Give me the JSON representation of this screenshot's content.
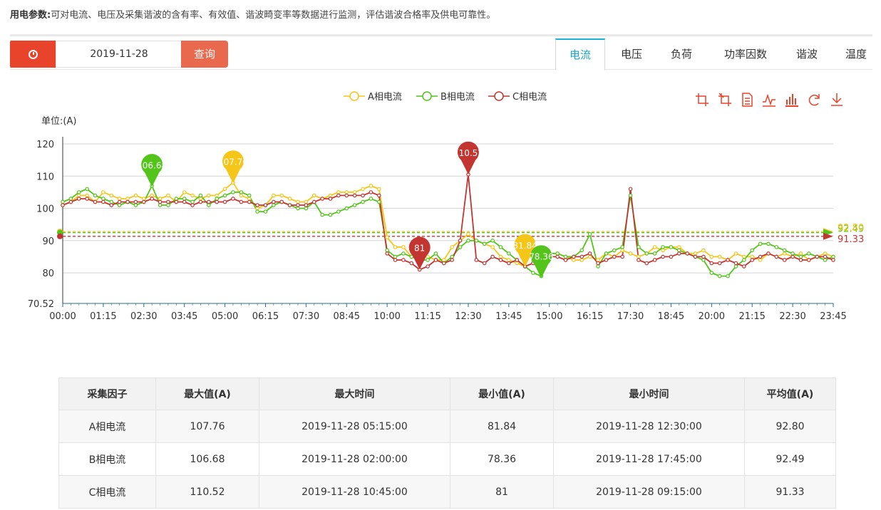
{
  "intro": {
    "label": "用电参数:",
    "text": "可对电流、电压及采集谐波的含有率、有效值、谐波畸变率等数据进行监测，评估谐波合格率及供电可靠性。"
  },
  "controls": {
    "clock_icon": "clock-icon",
    "date": "2019-11-28",
    "query_label": "查询"
  },
  "tabs": [
    {
      "label": "电流",
      "active": true
    },
    {
      "label": "电压",
      "active": false
    },
    {
      "label": "负荷",
      "active": false
    },
    {
      "label": "功率因数",
      "active": false
    },
    {
      "label": "谐波",
      "active": false
    },
    {
      "label": "温度",
      "active": false
    }
  ],
  "toolbox": {
    "icons": [
      "zoom-icon",
      "zoom-reset-icon",
      "data-view-icon",
      "line-chart-icon",
      "bar-chart-icon",
      "restore-icon",
      "download-icon"
    ],
    "color": "#e8442c"
  },
  "chart_data": {
    "type": "line",
    "ylabel": "单位:(A)",
    "ylim": [
      70.52,
      120
    ],
    "yticks": [
      120,
      110,
      100,
      90,
      80,
      70.52
    ],
    "x_tick_labels": [
      "00:00",
      "01:15",
      "02:30",
      "03:45",
      "05:00",
      "06:15",
      "07:30",
      "08:45",
      "10:00",
      "11:15",
      "12:30",
      "13:45",
      "15:00",
      "16:15",
      "17:30",
      "18:45",
      "20:00",
      "21:15",
      "22:30",
      "23:45"
    ],
    "interval_minutes": 15,
    "grid": true,
    "legend_position": "top-center",
    "series": [
      {
        "name": "A相电流",
        "color": "#f5c518",
        "values": [
          101,
          102,
          104,
          104,
          102,
          105,
          104,
          103,
          103,
          104,
          103,
          104,
          103,
          104,
          102,
          105,
          104,
          103,
          104,
          104,
          106,
          108,
          104,
          103,
          100,
          101,
          104,
          104,
          103,
          102,
          102,
          104,
          103,
          104,
          105,
          105,
          105,
          106,
          107,
          106,
          91,
          88,
          88,
          85,
          86,
          85,
          84,
          84,
          88,
          90,
          92,
          90,
          89,
          88,
          85,
          84,
          83,
          82,
          83,
          85,
          86,
          86,
          85,
          84,
          84,
          85,
          84,
          86,
          85,
          87,
          86,
          85,
          86,
          88,
          87,
          88,
          88,
          86,
          86,
          87,
          85,
          85,
          84,
          86,
          85,
          85,
          84,
          86,
          85,
          86,
          85,
          86,
          84,
          85,
          86,
          85
        ],
        "max": 107.76,
        "max_label": "107.76",
        "min": 81.84,
        "min_label": "81.84",
        "avg": 92.8
      },
      {
        "name": "B相电流",
        "color": "#52c41a",
        "values": [
          102,
          103,
          105,
          106,
          104,
          103,
          102,
          101,
          102,
          101,
          102,
          107,
          101,
          101,
          103,
          103,
          102,
          104,
          101,
          103,
          104,
          105,
          105,
          104,
          99,
          99,
          101,
          102,
          101,
          100,
          100,
          102,
          98,
          98,
          99,
          100,
          101,
          102,
          103,
          102,
          87,
          85,
          86,
          85,
          84,
          84,
          86,
          83,
          85,
          88,
          90,
          90,
          89,
          90,
          88,
          86,
          84,
          82,
          80,
          79,
          86,
          86,
          85,
          85,
          87,
          92,
          82,
          86,
          87,
          88,
          104,
          88,
          86,
          86,
          88,
          88,
          87,
          86,
          85,
          84,
          80,
          79,
          79,
          82,
          84,
          87,
          89,
          89,
          88,
          87,
          86,
          85,
          86,
          85,
          84,
          85
        ],
        "max": 106.68,
        "max_label": "106.68",
        "min": 78.36,
        "min_label": "78.36",
        "avg": 92.49
      },
      {
        "name": "C相电流",
        "color": "#c23531",
        "values": [
          101,
          102,
          103,
          103,
          102,
          102,
          101,
          102,
          102,
          102,
          102,
          103,
          102,
          102,
          102,
          102,
          101,
          102,
          102,
          102,
          102,
          103,
          102,
          102,
          101,
          101,
          102,
          102,
          101,
          101,
          101,
          102,
          103,
          103,
          104,
          104,
          104,
          104,
          105,
          104,
          86,
          84,
          84,
          83,
          81,
          82,
          84,
          83,
          84,
          90,
          110.52,
          84,
          83,
          85,
          84,
          83,
          84,
          82,
          83,
          84,
          85,
          85,
          84,
          85,
          85,
          86,
          83,
          84,
          85,
          85,
          106,
          84,
          83,
          84,
          85,
          85,
          86,
          86,
          85,
          85,
          83,
          83,
          84,
          83,
          82,
          84,
          85,
          86,
          85,
          84,
          85,
          84,
          84,
          85,
          85,
          84
        ],
        "max": 110.52,
        "max_label": "110.52",
        "min": 81,
        "min_label": "81",
        "avg": 91.33
      }
    ]
  },
  "table": {
    "headers": [
      "采集因子",
      "最大值(A)",
      "最大时间",
      "最小值(A)",
      "最小时间",
      "平均值(A)"
    ],
    "rows": [
      [
        "A相电流",
        "107.76",
        "2019-11-28 05:15:00",
        "81.84",
        "2019-11-28 12:30:00",
        "92.80"
      ],
      [
        "B相电流",
        "106.68",
        "2019-11-28 02:00:00",
        "78.36",
        "2019-11-28 17:45:00",
        "92.49"
      ],
      [
        "C相电流",
        "110.52",
        "2019-11-28 10:45:00",
        "81",
        "2019-11-28 09:15:00",
        "91.33"
      ]
    ]
  }
}
